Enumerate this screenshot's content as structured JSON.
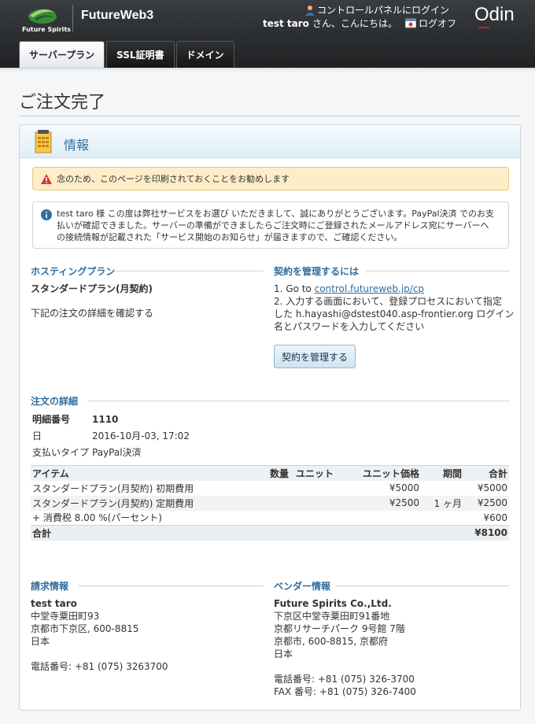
{
  "header": {
    "logo_text": "Future Spirits",
    "product": "FutureWeb3",
    "cp_login": "コントロールパネルにログイン",
    "user": "test taro",
    "greeting": "さん、こんにちは。",
    "logoff": "ログオフ",
    "brand": "Odin"
  },
  "tabs": [
    {
      "label": "サーバープラン",
      "active": true
    },
    {
      "label": "SSL証明書",
      "active": false
    },
    {
      "label": "ドメイン",
      "active": false
    }
  ],
  "page_title": "ご注文完了",
  "panel": {
    "title": "情報",
    "warning": "念のため、このページを印刷されておくことをお勧めします",
    "info_line1": "test taro 様 この度は弊社サービスをお選び いただきまして、誠にありがとうございます。PayPal決済 でのお支",
    "info_line2": "払いが確認できました。サーバーの準備ができましたらご注文時にご登録されたメールアドレス宛にサーバーへ",
    "info_line3": "の接続情報が記載された「サービス開始のお知らせ」が届きますので、ご確認ください。"
  },
  "hosting": {
    "title": "ホスティングプラン",
    "plan": "スタンダードプラン(月契約)",
    "confirm": "下記の注文の詳細を確認する"
  },
  "manage": {
    "title": "契約を管理するには",
    "step1_prefix": "1. Go to ",
    "step1_link": "control.futureweb.jp/cp",
    "step2_line1": "2. 入力する画面において、登録プロセスにおいて指定",
    "step2_line2": "した h.hayashi@dstest040.asp-frontier.org ログイン",
    "step2_line3": "名とパスワードを入力してください",
    "button": "契約を管理する"
  },
  "order": {
    "title": "注文の詳細",
    "number_label": "明細番号",
    "number": "1110",
    "date_label": "日",
    "date": "2016-10月-03, 17:02",
    "pay_label": "支払いタイプ",
    "pay": "PayPal決済",
    "columns": [
      "アイテム",
      "数量",
      "ユニット",
      "ユニット価格",
      "期間",
      "合計"
    ],
    "rows": [
      {
        "item": "スタンダードプラン(月契約) 初期費用",
        "qty": "",
        "unit": "",
        "price": "¥5000",
        "period": "",
        "total": "¥5000"
      },
      {
        "item": "スタンダードプラン(月契約) 定期費用",
        "qty": "",
        "unit": "",
        "price": "¥2500",
        "period": "1 ヶ月",
        "total": "¥2500"
      },
      {
        "item": "+ 消費税 8.00 %(パーセント)",
        "qty": "",
        "unit": "",
        "price": "",
        "period": "",
        "total": "¥600"
      }
    ],
    "total_label": "合計",
    "total": "¥8100"
  },
  "billing": {
    "title": "請求情報",
    "name": "test taro",
    "addr1": "中堂寺粟田町93",
    "addr2": "京都市下京区, 600-8815",
    "country": "日本",
    "phone": "電話番号: +81 (075) 3263700"
  },
  "vendor": {
    "title": "ベンダー情報",
    "name": "Future Spirits Co.,Ltd.",
    "addr1": "下京区中堂寺粟田町91番地",
    "addr2": "京都リサーチパーク 9号館 7階",
    "addr3": "京都市, 600-8815, 京都府",
    "country": "日本",
    "phone": "電話番号: +81 (075) 326-3700",
    "fax": "FAX 番号: +81 (075) 326-7400"
  }
}
